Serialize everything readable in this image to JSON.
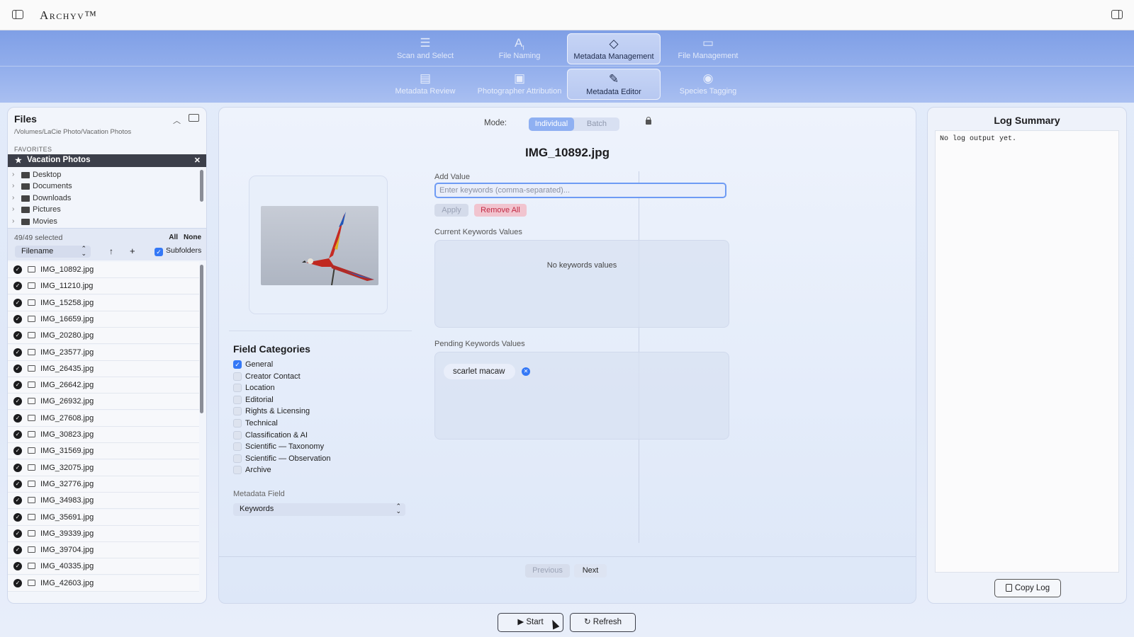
{
  "app": {
    "title": "Archyv™"
  },
  "nav": {
    "row1": [
      {
        "label": "Scan and Select",
        "icon": "scan-select-icon"
      },
      {
        "label": "File Naming",
        "icon": "ai-text-icon"
      },
      {
        "label": "Metadata Management",
        "icon": "tag-icon",
        "active": true
      },
      {
        "label": "File Management",
        "icon": "folder-icon"
      }
    ],
    "row2": [
      {
        "label": "Metadata Review",
        "icon": "review-list-icon"
      },
      {
        "label": "Photographer Attribution",
        "icon": "id-card-icon"
      },
      {
        "label": "Metadata Editor",
        "icon": "edit-icon",
        "active": true
      },
      {
        "label": "Species Tagging",
        "icon": "species-tag-icon"
      }
    ]
  },
  "files": {
    "title": "Files",
    "path": "/Volumes/LaCie Photo/Vacation Photos",
    "favorites_label": "FAVORITES",
    "favorite": "Vacation Photos",
    "tree": [
      "Desktop",
      "Documents",
      "Downloads",
      "Pictures",
      "Movies"
    ],
    "selected_count": "49/49 selected",
    "all_label": "All",
    "none_label": "None",
    "sort_by": "Filename",
    "subfolders_label": "Subfolders",
    "list": [
      "IMG_10892.jpg",
      "IMG_11210.jpg",
      "IMG_15258.jpg",
      "IMG_16659.jpg",
      "IMG_20280.jpg",
      "IMG_23577.jpg",
      "IMG_26435.jpg",
      "IMG_26642.jpg",
      "IMG_26932.jpg",
      "IMG_27608.jpg",
      "IMG_30823.jpg",
      "IMG_31569.jpg",
      "IMG_32075.jpg",
      "IMG_32776.jpg",
      "IMG_34983.jpg",
      "IMG_35691.jpg",
      "IMG_39339.jpg",
      "IMG_39704.jpg",
      "IMG_40335.jpg",
      "IMG_42603.jpg"
    ]
  },
  "editor": {
    "mode_label": "Mode:",
    "modes": [
      "Individual",
      "Batch"
    ],
    "active_mode": "Individual",
    "filename": "IMG_10892.jpg",
    "field_categories_title": "Field Categories",
    "field_categories": [
      {
        "label": "General",
        "checked": true
      },
      {
        "label": "Creator Contact",
        "checked": false
      },
      {
        "label": "Location",
        "checked": false
      },
      {
        "label": "Editorial",
        "checked": false
      },
      {
        "label": "Rights & Licensing",
        "checked": false
      },
      {
        "label": "Technical",
        "checked": false
      },
      {
        "label": "Classification & AI",
        "checked": false
      },
      {
        "label": "Scientific — Taxonomy",
        "checked": false
      },
      {
        "label": "Scientific — Observation",
        "checked": false
      },
      {
        "label": "Archive",
        "checked": false
      }
    ],
    "metadata_field_label": "Metadata Field",
    "metadata_field_value": "Keywords",
    "add_value_label": "Add Value",
    "input_placeholder": "Enter keywords (comma-separated)...",
    "input_value": "",
    "apply_label": "Apply",
    "remove_all_label": "Remove All",
    "current_label": "Current Keywords Values",
    "current_empty": "No keywords values",
    "pending_label": "Pending Keywords Values",
    "pending": [
      "scarlet macaw"
    ],
    "previous_label": "Previous",
    "next_label": "Next"
  },
  "log": {
    "title": "Log Summary",
    "text": "No log output yet.",
    "copy_label": "Copy Log"
  },
  "actions": {
    "start_label": "Start",
    "refresh_label": "Refresh"
  },
  "colors": {
    "accent": "#3478f6",
    "nav_bar": "#8fa9ea",
    "danger": "#c22a44"
  }
}
